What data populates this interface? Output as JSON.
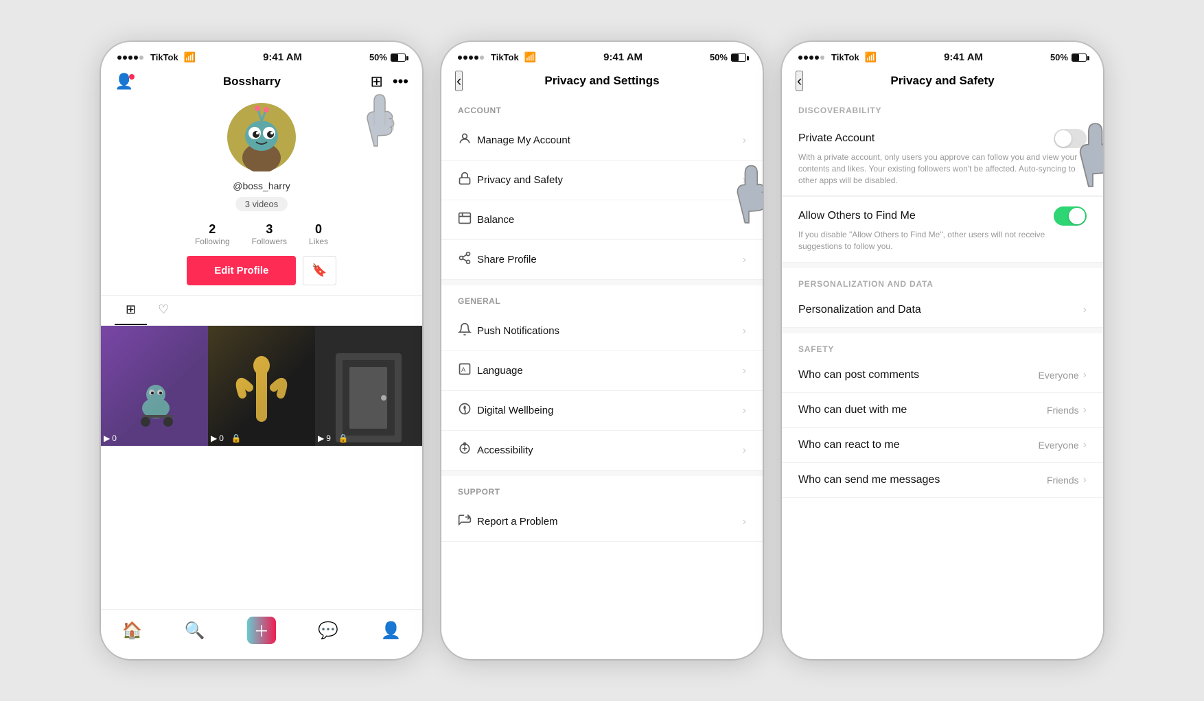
{
  "app": {
    "name": "TikTok",
    "status_bar": {
      "carrier": "TikTok",
      "time": "9:41 AM",
      "battery": "50%"
    }
  },
  "screen1": {
    "title": "Bossharry",
    "handle": "@boss_harry",
    "videos_badge": "3 videos",
    "stats": {
      "following": {
        "count": "2",
        "label": "Following"
      },
      "followers": {
        "count": "3",
        "label": "Followers"
      },
      "likes": {
        "count": "0",
        "label": "Likes"
      }
    },
    "edit_profile_btn": "Edit Profile",
    "tabs": {
      "grid": "⊞",
      "heart": "♡"
    },
    "videos": [
      {
        "views": "0",
        "lock": false
      },
      {
        "views": "0",
        "lock": true
      },
      {
        "views": "9",
        "lock": true
      }
    ],
    "bottom_nav": {
      "home": "Home",
      "search": "Search",
      "create": "+",
      "inbox": "Inbox",
      "profile": "Profile"
    }
  },
  "screen2": {
    "title": "Privacy and Settings",
    "back": "‹",
    "sections": {
      "account": {
        "label": "ACCOUNT",
        "items": [
          {
            "icon": "👤",
            "label": "Manage My Account"
          },
          {
            "icon": "🔒",
            "label": "Privacy and Safety"
          },
          {
            "icon": "🗂",
            "label": "Balance"
          },
          {
            "icon": "↗",
            "label": "Share Profile"
          }
        ]
      },
      "general": {
        "label": "GENERAL",
        "items": [
          {
            "icon": "🔔",
            "label": "Push Notifications"
          },
          {
            "icon": "A",
            "label": "Language"
          },
          {
            "icon": "☂",
            "label": "Digital Wellbeing"
          },
          {
            "icon": "♿",
            "label": "Accessibility"
          }
        ]
      },
      "support": {
        "label": "SUPPORT",
        "items": [
          {
            "icon": "✏",
            "label": "Report a Problem"
          }
        ]
      }
    }
  },
  "screen3": {
    "title": "Privacy and Safety",
    "back": "‹",
    "sections": {
      "discoverability": {
        "label": "DISCOVERABILITY",
        "items": [
          {
            "name": "Private Account",
            "toggle": "off",
            "desc": "With a private account, only users you approve can follow you and view your contents and likes. Your existing followers won't be affected. Auto-syncing to other apps will be disabled."
          },
          {
            "name": "Allow Others to Find Me",
            "toggle": "on",
            "desc": "If you disable \"Allow Others to Find Me\", other users will not receive suggestions to follow you."
          }
        ]
      },
      "personalization": {
        "label": "PERSONALIZATION AND DATA",
        "items": [
          {
            "label": "Personalization and Data",
            "value": ""
          }
        ]
      },
      "safety": {
        "label": "SAFETY",
        "items": [
          {
            "label": "Who can post comments",
            "value": "Everyone"
          },
          {
            "label": "Who can duet with me",
            "value": "Friends"
          },
          {
            "label": "Who can react to me",
            "value": "Everyone"
          },
          {
            "label": "Who can send me messages",
            "value": "Friends"
          }
        ]
      }
    }
  }
}
